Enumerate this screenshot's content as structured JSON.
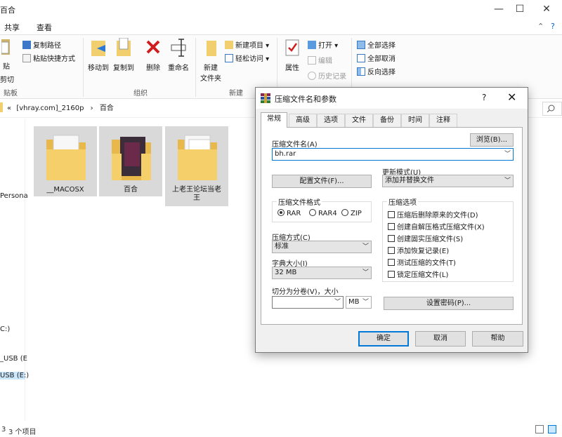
{
  "explorer": {
    "title": "百合",
    "window_controls": {
      "minimize": "—",
      "maximize": "☐",
      "close": "✕"
    },
    "menu": {
      "share": "共享",
      "view": "查看",
      "help_chevron": "⌃",
      "help": "?"
    },
    "ribbon": {
      "paste_label": "贴",
      "cut_label": "剪切",
      "copy_path": "复制路径",
      "paste_shortcut": "粘贴快捷方式",
      "clipboard_group": "贴板",
      "move_to": "移动到",
      "copy_to": "复制到",
      "delete": "删除",
      "rename": "重命名",
      "organize_group": "组织",
      "new_folder_line1": "新建",
      "new_folder_line2": "文件夹",
      "new_item": "新建项目",
      "easy_access": "轻松访问",
      "new_group": "新建",
      "properties": "属性",
      "open": "打开",
      "edit": "编辑",
      "history": "历史记录",
      "select_all": "全部选择",
      "select_none": "全部取消",
      "invert_selection": "反向选择"
    },
    "address": {
      "chevron": "«",
      "crumb1": "[vhray.com]_2160p",
      "sep": "›",
      "crumb2": "百合"
    },
    "nav": {
      "item1": "Persona",
      "item2": "C:)",
      "item3": "_USB (E",
      "item4": "USB (E:)"
    },
    "files": [
      {
        "name": "__MACOSX"
      },
      {
        "name": "百合"
      },
      {
        "name": "上老王论坛当老王"
      }
    ],
    "status": "3 个项目",
    "status_prefix": "3"
  },
  "dialog": {
    "title": "压缩文件名和参数",
    "help": "?",
    "close": "✕",
    "tabs": [
      "常规",
      "高级",
      "选项",
      "文件",
      "备份",
      "时间",
      "注释"
    ],
    "archive_name_label": "压缩文件名(A)",
    "archive_name_value": "bh.rar",
    "browse": "浏览(B)...",
    "profiles": "配置文件(F)...",
    "update_mode_label": "更新模式(U)",
    "update_mode_value": "添加并替换文件",
    "format_group": "压缩文件格式",
    "formats": {
      "rar": "RAR",
      "rar4": "RAR4",
      "zip": "ZIP"
    },
    "method_label": "压缩方式(C)",
    "method_value": "标准",
    "dict_label": "字典大小(I)",
    "dict_value": "32 MB",
    "split_label": "切分为分卷(V)，大小",
    "split_unit": "MB",
    "options_group": "压缩选项",
    "options": [
      "压缩后删除原来的文件(D)",
      "创建自解压格式压缩文件(X)",
      "创建固实压缩文件(S)",
      "添加恢复记录(E)",
      "测试压缩的文件(T)",
      "锁定压缩文件(L)"
    ],
    "set_password": "设置密码(P)...",
    "ok": "确定",
    "cancel": "取消",
    "help_btn": "帮助"
  }
}
